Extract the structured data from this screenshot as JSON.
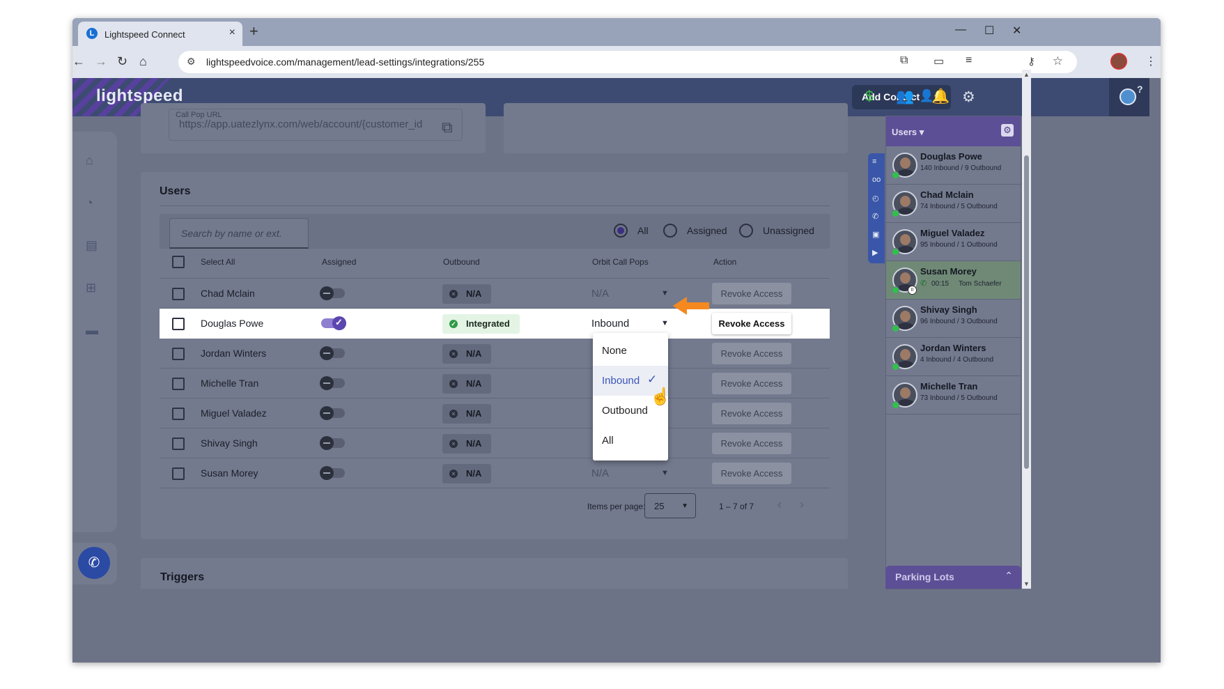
{
  "browser": {
    "tab_title": "Lightspeed Connect",
    "tab_favicon": "L",
    "new_tab": "+",
    "url": "lightspeedvoice.com/management/lead-settings/integrations/255",
    "icons": [
      "back-icon",
      "forward-icon",
      "reload-icon",
      "home-icon",
      "key-icon",
      "star-icon",
      "extensions-icon",
      "reading-icon",
      "media-icon",
      "profile-avatar",
      "menu-icon"
    ]
  },
  "header": {
    "logo": "lightspeed",
    "add_contact": "Add Contact",
    "brand_color": "#3d4b72",
    "accent_color": "#5c4f95"
  },
  "call_pop": {
    "label": "Call Pop URL",
    "value": "https://app.uatezlynx.com/web/account/{customer_id"
  },
  "users_section": {
    "title": "Users",
    "search_placeholder": "Search by name or ext.",
    "filters": [
      {
        "label": "All",
        "selected": true
      },
      {
        "label": "Assigned",
        "selected": false
      },
      {
        "label": "Unassigned",
        "selected": false
      }
    ],
    "columns": {
      "select_all": "Select All",
      "assigned": "Assigned",
      "outbound": "Outbound",
      "orbit_call_pops": "Orbit Call Pops",
      "action": "Action"
    },
    "rows": [
      {
        "name": "Chad Mclain",
        "assigned": false,
        "outbound": "N/A",
        "call_pop": "N/A",
        "action": "Revoke Access"
      },
      {
        "name": "Douglas Powe",
        "assigned": true,
        "outbound": "Integrated",
        "call_pop": "Inbound",
        "action": "Revoke Access"
      },
      {
        "name": "Jordan Winters",
        "assigned": false,
        "outbound": "N/A",
        "call_pop": "",
        "action": "Revoke Access"
      },
      {
        "name": "Michelle Tran",
        "assigned": false,
        "outbound": "N/A",
        "call_pop": "",
        "action": "Revoke Access"
      },
      {
        "name": "Miguel Valadez",
        "assigned": false,
        "outbound": "N/A",
        "call_pop": "",
        "action": "Revoke Access"
      },
      {
        "name": "Shivay Singh",
        "assigned": false,
        "outbound": "N/A",
        "call_pop": "",
        "action": "Revoke Access"
      },
      {
        "name": "Susan Morey",
        "assigned": false,
        "outbound": "N/A",
        "call_pop": "N/A",
        "action": "Revoke Access"
      }
    ],
    "dropdown_options": [
      {
        "label": "None",
        "selected": false
      },
      {
        "label": "Inbound",
        "selected": true
      },
      {
        "label": "Outbound",
        "selected": false
      },
      {
        "label": "All",
        "selected": false
      }
    ],
    "pagination": {
      "items_per_page_label": "Items per page:",
      "items_per_page": "25",
      "range": "1 – 7 of 7"
    }
  },
  "triggers_section": {
    "title": "Triggers"
  },
  "right_panel": {
    "header": "Users",
    "users": [
      {
        "name": "Douglas Powe",
        "stats": "140 Inbound / 9 Outbound"
      },
      {
        "name": "Chad Mclain",
        "stats": "74 Inbound / 5 Outbound"
      },
      {
        "name": "Miguel Valadez",
        "stats": "95 Inbound / 1 Outbound"
      },
      {
        "name": "Susan Morey",
        "call_time": "00:15",
        "call_partner": "Tom Schaefer",
        "on_call": true
      },
      {
        "name": "Shivay Singh",
        "stats": "96 Inbound / 3 Outbound"
      },
      {
        "name": "Jordan Winters",
        "stats": "4 Inbound / 4 Outbound"
      },
      {
        "name": "Michelle Tran",
        "stats": "73 Inbound / 5 Outbound"
      }
    ],
    "parking_lots": "Parking Lots"
  }
}
